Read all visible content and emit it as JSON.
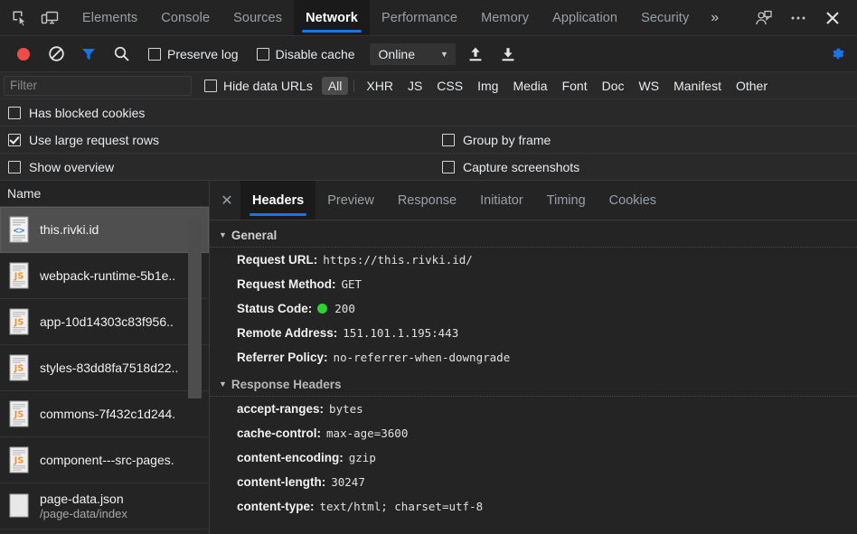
{
  "tabbar": {
    "left_icons": [
      {
        "name": "inspect-element-icon",
        "label": "Inspect element"
      },
      {
        "name": "device-toolbar-icon",
        "label": "Toggle device toolbar"
      }
    ],
    "tabs": [
      {
        "label": "Elements",
        "active": false
      },
      {
        "label": "Console",
        "active": false
      },
      {
        "label": "Sources",
        "active": false
      },
      {
        "label": "Network",
        "active": true
      },
      {
        "label": "Performance",
        "active": false
      },
      {
        "label": "Memory",
        "active": false
      },
      {
        "label": "Application",
        "active": false
      },
      {
        "label": "Security",
        "active": false
      }
    ],
    "more_tabs": "»",
    "right_icons": [
      {
        "name": "account-icon",
        "label": "Account"
      },
      {
        "name": "more-options-icon",
        "label": "· · ·"
      },
      {
        "name": "close-devtools-icon",
        "label": "✕"
      }
    ]
  },
  "toolbar": {
    "record_label": "Record",
    "clear_label": "Clear",
    "filter_label": "Filter",
    "search_label": "Search",
    "preserve_log": {
      "label": "Preserve log",
      "checked": false
    },
    "disable_cache": {
      "label": "Disable cache",
      "checked": false
    },
    "throttle": {
      "value": "Online",
      "caret": "▼"
    },
    "import_har_label": "Import HAR file",
    "export_har_label": "Export HAR file",
    "settings_label": "Settings"
  },
  "filterbar": {
    "filter_placeholder": "Filter",
    "filter_value": "",
    "hide_data_urls": {
      "label": "Hide data URLs",
      "checked": false
    },
    "types": [
      {
        "label": "All",
        "active": true
      },
      {
        "label": "XHR",
        "active": false
      },
      {
        "label": "JS",
        "active": false
      },
      {
        "label": "CSS",
        "active": false
      },
      {
        "label": "Img",
        "active": false
      },
      {
        "label": "Media",
        "active": false
      },
      {
        "label": "Font",
        "active": false
      },
      {
        "label": "Doc",
        "active": false
      },
      {
        "label": "WS",
        "active": false
      },
      {
        "label": "Manifest",
        "active": false
      },
      {
        "label": "Other",
        "active": false
      }
    ]
  },
  "options": {
    "has_blocked_cookies": {
      "label": "Has blocked cookies",
      "checked": false
    },
    "use_large_request_rows": {
      "label": "Use large request rows",
      "checked": true
    },
    "group_by_frame": {
      "label": "Group by frame",
      "checked": false
    },
    "show_overview": {
      "label": "Show overview",
      "checked": false
    },
    "capture_screenshots": {
      "label": "Capture screenshots",
      "checked": false
    }
  },
  "requests": {
    "column_header": "Name",
    "rows": [
      {
        "name": "this.rivki.id",
        "sub": "",
        "icon": "document-file-icon",
        "selected": true
      },
      {
        "name": "webpack-runtime-5b1e..",
        "sub": "",
        "icon": "js-file-icon",
        "selected": false
      },
      {
        "name": "app-10d14303c83f956..",
        "sub": "",
        "icon": "js-file-icon",
        "selected": false
      },
      {
        "name": "styles-83dd8fa7518d22..",
        "sub": "",
        "icon": "js-file-icon",
        "selected": false
      },
      {
        "name": "commons-7f432c1d244.",
        "sub": "",
        "icon": "js-file-icon",
        "selected": false
      },
      {
        "name": "component---src-pages.",
        "sub": "",
        "icon": "js-file-icon",
        "selected": false
      },
      {
        "name": "page-data.json",
        "sub": "/page-data/index",
        "icon": "json-file-icon",
        "selected": false
      }
    ]
  },
  "detail": {
    "close_label": "✕",
    "tabs": [
      {
        "label": "Headers",
        "active": true
      },
      {
        "label": "Preview",
        "active": false
      },
      {
        "label": "Response",
        "active": false
      },
      {
        "label": "Initiator",
        "active": false
      },
      {
        "label": "Timing",
        "active": false
      },
      {
        "label": "Cookies",
        "active": false
      }
    ],
    "general": {
      "title": "General",
      "triangle": "▼",
      "items": [
        {
          "key": "Request URL:",
          "value": "https://this.rivki.id/",
          "status": false
        },
        {
          "key": "Request Method:",
          "value": "GET",
          "status": false
        },
        {
          "key": "Status Code:",
          "value": "200",
          "status": true
        },
        {
          "key": "Remote Address:",
          "value": "151.101.1.195:443",
          "status": false
        },
        {
          "key": "Referrer Policy:",
          "value": "no-referrer-when-downgrade",
          "status": false
        }
      ]
    },
    "response_headers": {
      "title": "Response Headers",
      "triangle": "▼",
      "items": [
        {
          "key": "accept-ranges:",
          "value": "bytes"
        },
        {
          "key": "cache-control:",
          "value": "max-age=3600"
        },
        {
          "key": "content-encoding:",
          "value": "gzip"
        },
        {
          "key": "content-length:",
          "value": "30247"
        },
        {
          "key": "content-type:",
          "value": "text/html; charset=utf-8"
        }
      ]
    }
  },
  "colors": {
    "accent_blue": "#1a73e8",
    "record_red": "#ef4b4b",
    "status_green": "#29d630",
    "js_orange": "#f0922b",
    "background": "#242424"
  }
}
